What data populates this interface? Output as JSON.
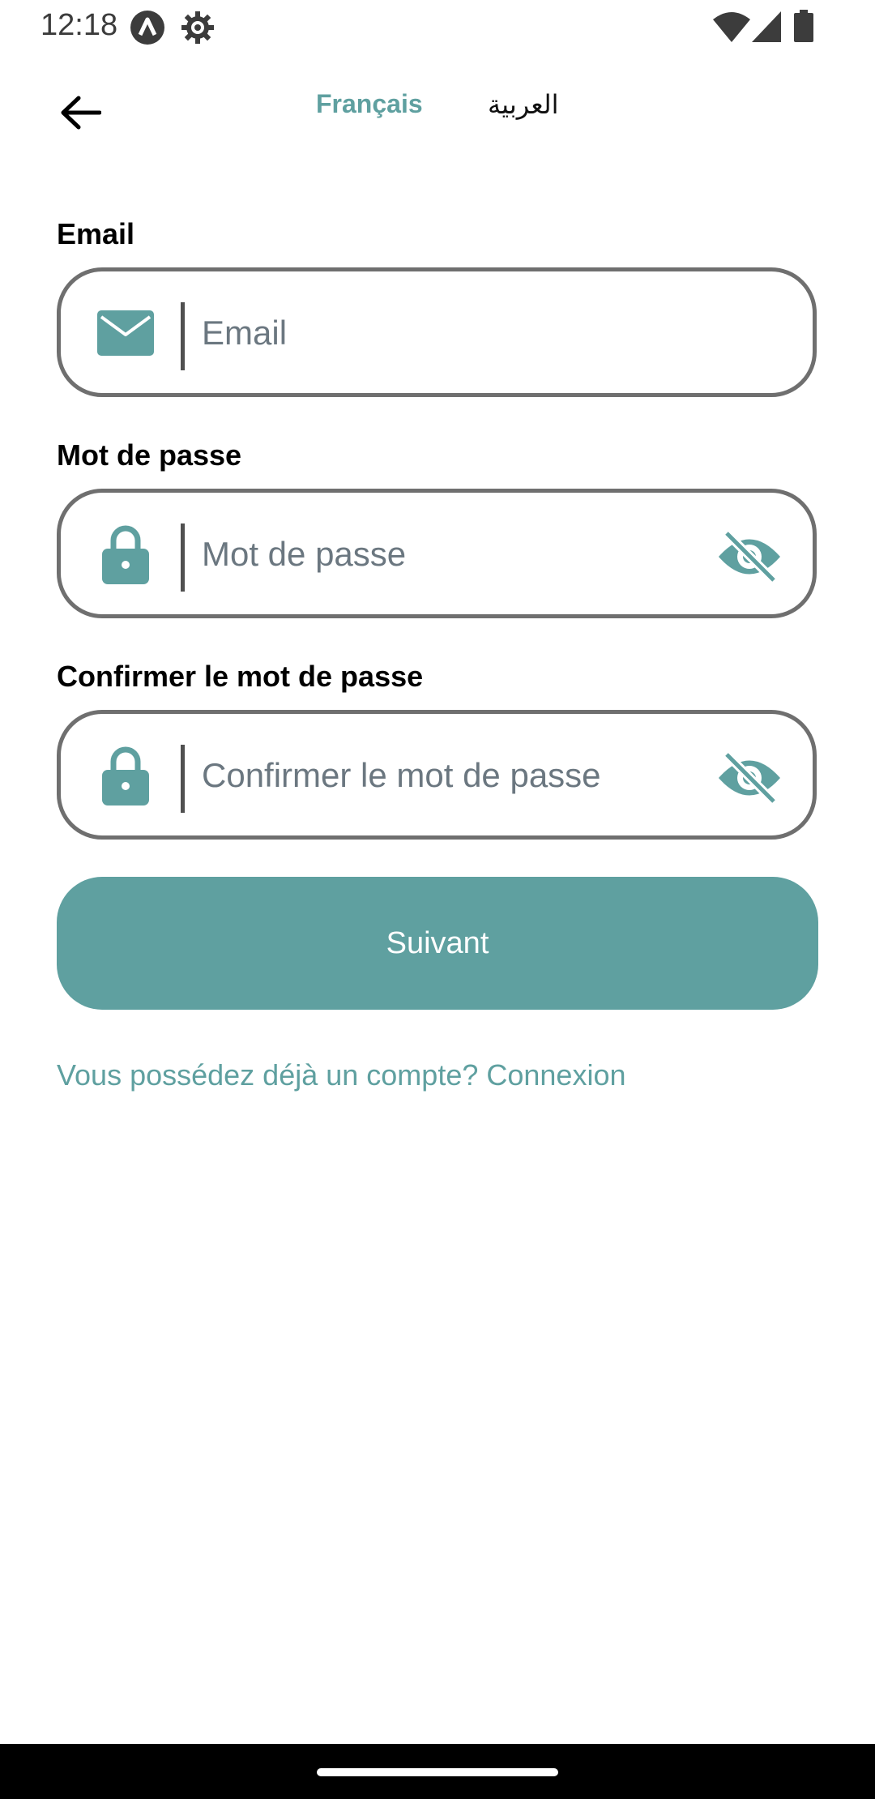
{
  "status_bar": {
    "time": "12:18",
    "icons": [
      "a-circle-icon",
      "gear-icon",
      "wifi-icon",
      "signal-icon",
      "battery-icon"
    ]
  },
  "top_bar": {
    "back_icon": "arrow-left-icon",
    "languages": [
      {
        "label": "Français",
        "selected": true
      },
      {
        "label": "العربية",
        "selected": false
      }
    ]
  },
  "form": {
    "email": {
      "label": "Email",
      "placeholder": "Email",
      "value": "",
      "icon": "envelope-icon"
    },
    "password": {
      "label": "Mot de passe",
      "placeholder": "Mot de passe",
      "value": "",
      "icon": "lock-icon",
      "toggle_icon": "eye-off-icon"
    },
    "confirm_password": {
      "label": "Confirmer le mot de passe",
      "placeholder": "Confirmer le mot de passe",
      "value": "",
      "icon": "lock-icon",
      "toggle_icon": "eye-off-icon"
    },
    "submit_label": "Suivant",
    "login_link": "Vous possédez déjà un compte? Connexion"
  },
  "colors": {
    "accent": "#5fa0a0",
    "field_border": "#6f6f6f",
    "text": "#000000",
    "placeholder": "#6b7780",
    "nav_bar": "#000000"
  }
}
